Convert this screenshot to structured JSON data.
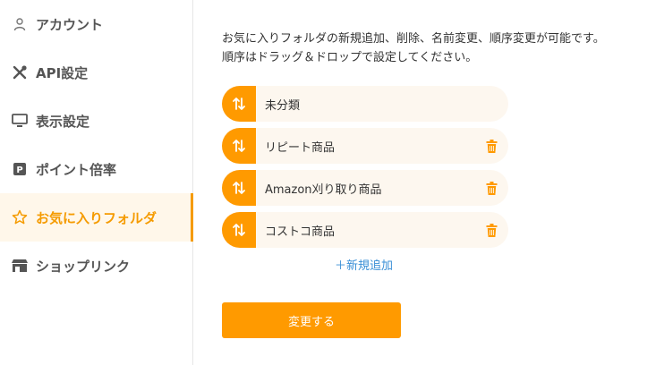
{
  "sidebar": {
    "items": [
      {
        "label": "アカウント",
        "icon": "user-icon"
      },
      {
        "label": "API設定",
        "icon": "tools-icon"
      },
      {
        "label": "表示設定",
        "icon": "monitor-icon"
      },
      {
        "label": "ポイント倍率",
        "icon": "points-icon"
      },
      {
        "label": "お気に入りフォルダ",
        "icon": "star-icon",
        "active": true
      },
      {
        "label": "ショップリンク",
        "icon": "shop-icon"
      }
    ]
  },
  "main": {
    "description_line1": "お気に入りフォルダの新規追加、削除、名前変更、順序変更が可能です。",
    "description_line2": "順序はドラッグ＆ドロップで設定してください。",
    "folders": [
      {
        "name": "未分類",
        "deletable": false
      },
      {
        "name": "リピート商品",
        "deletable": true
      },
      {
        "name": "Amazon刈り取り商品",
        "deletable": true
      },
      {
        "name": "コストコ商品",
        "deletable": true
      }
    ],
    "add_label": "＋新規追加",
    "submit_label": "変更する"
  },
  "colors": {
    "accent": "#ff9a00",
    "active_bg": "#fff7ea",
    "row_bg": "#fdf7ef",
    "link": "#3a8fd6"
  }
}
